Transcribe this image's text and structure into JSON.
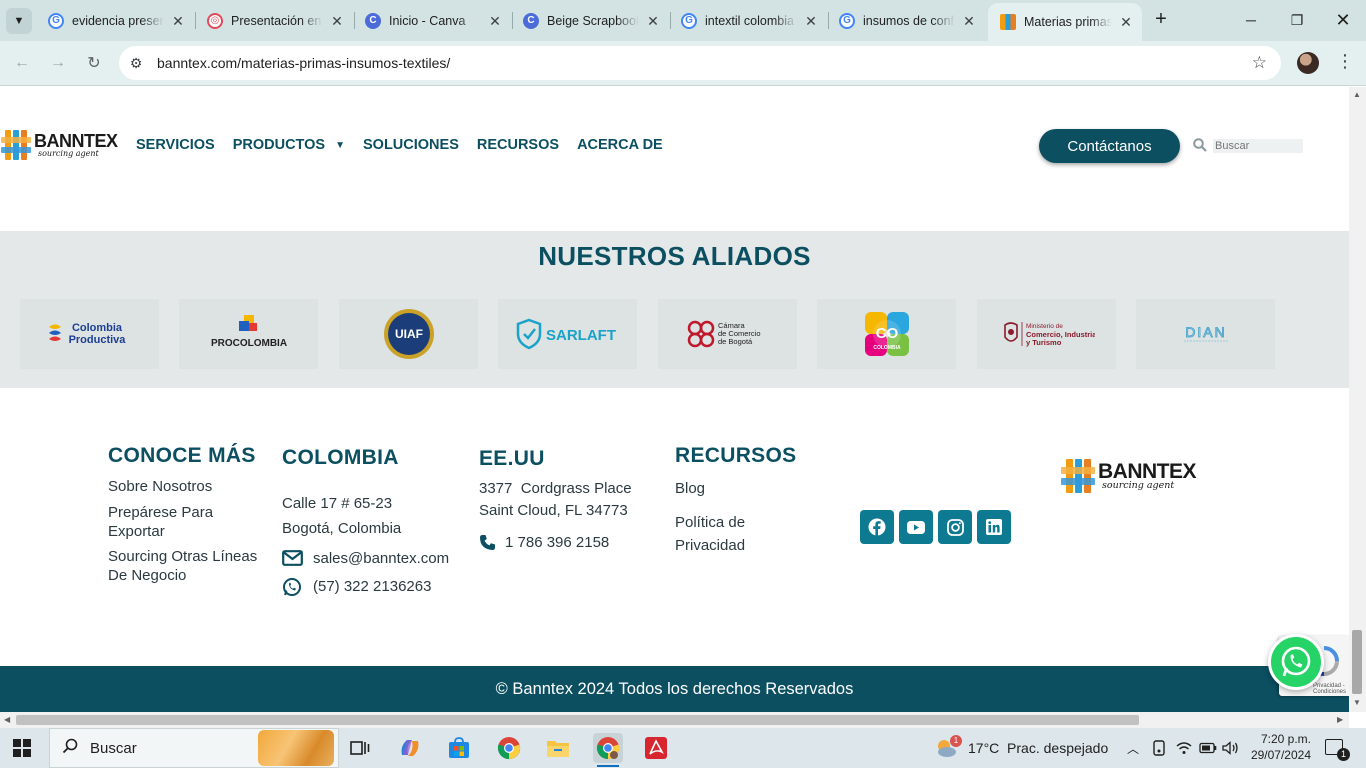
{
  "browser": {
    "tabs": [
      {
        "title": "evidencia presen",
        "favicon": "google-icon"
      },
      {
        "title": "Presentación en",
        "favicon": "pinterest-like-icon"
      },
      {
        "title": "Inicio - Canva",
        "favicon": "canva-icon"
      },
      {
        "title": "Beige Scrapbook",
        "favicon": "canva-icon"
      },
      {
        "title": "intextil colombia",
        "favicon": "google-icon"
      },
      {
        "title": "insumos de conf",
        "favicon": "google-icon"
      },
      {
        "title": "Materias primas",
        "favicon": "banntex-icon"
      }
    ],
    "active_tab_index": 6,
    "url": "banntex.com/materias-primas-insumos-textiles/"
  },
  "site": {
    "logo": {
      "brand": "BANNTEX",
      "tagline": "sourcing agent"
    },
    "nav": [
      "SERVICIOS",
      "PRODUCTOS",
      "SOLUCIONES",
      "RECURSOS",
      "ACERCA DE"
    ],
    "contact_label": "Contáctanos",
    "search_placeholder": "Buscar",
    "allies_title": "NUESTROS ALIADOS",
    "allies": [
      {
        "name": "Colombia Productiva",
        "line1": "Colombia",
        "line2": "Productiva"
      },
      {
        "name": "PROCOLOMBIA",
        "line1": "PROCOLOMBIA"
      },
      {
        "name": "UIAF",
        "line1": "UIAF"
      },
      {
        "name": "SARLAFT",
        "line1": "SARLAFT"
      },
      {
        "name": "Cámara de Comercio de Bogotá",
        "line1": "Cámara",
        "line2": "de Comercio",
        "line3": "de Bogotá"
      },
      {
        "name": "CO Colombia",
        "line1": "CO",
        "line2": "COLOMBIA"
      },
      {
        "name": "Ministerio de Comercio, Industria y Turismo",
        "line1": "Ministerio de",
        "line2": "Comercio, Industria",
        "line3": "y Turismo"
      },
      {
        "name": "DIAN",
        "line1": "DIAN"
      }
    ],
    "footer": {
      "conoce": {
        "title": "CONOCE MÁS",
        "links": [
          "Sobre Nosotros",
          "Prepárese Para Exportar",
          "Sourcing Otras Líneas De Negocio"
        ]
      },
      "colombia": {
        "title": "COLOMBIA",
        "address1": "Calle 17 # 65-23",
        "address2": "Bogotá, Colombia",
        "email": "sales@banntex.com",
        "whatsapp": "(57) 322 2136263"
      },
      "eeuu": {
        "title": "EE.UU",
        "address1": "3377  Cordgrass Place",
        "address2": "Saint Cloud, FL 34773",
        "phone": "1 786 396 2158"
      },
      "recursos": {
        "title": "RECURSOS",
        "links": [
          "Blog",
          "Política de Privacidad"
        ]
      },
      "social": [
        "facebook-icon",
        "youtube-icon",
        "instagram-icon",
        "linkedin-icon"
      ],
      "copyright": "© Banntex 2024 Todos los derechos Reservados"
    },
    "recaptcha_text": "Privacidad - Condiciones"
  },
  "taskbar": {
    "search_label": "Buscar",
    "weather": "17°C  Prac. despejado",
    "weather_badge": "1",
    "time": "7:20 p.m.",
    "date": "29/07/2024",
    "notifications": "1"
  },
  "colors": {
    "brand_teal": "#0b4f61",
    "social_teal": "#0e7a92",
    "allies_bg": "#e4e8e9",
    "whatsapp_green": "#25d366"
  }
}
